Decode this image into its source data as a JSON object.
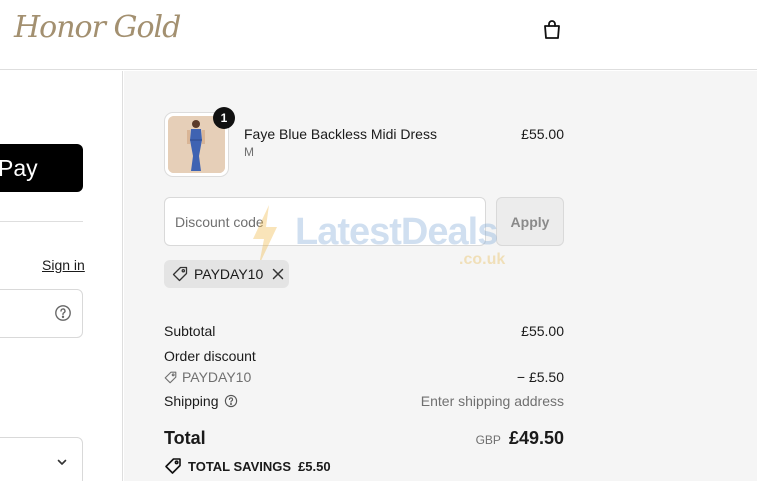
{
  "header": {
    "logo_text": "Honor Gold",
    "cart_icon": "shopping-bag-icon"
  },
  "left": {
    "pay_label": "Pay",
    "sign_in": "Sign in"
  },
  "order": {
    "product": {
      "name": "Faye Blue Backless Midi Dress",
      "variant": "M",
      "price": "£55.00",
      "quantity": "1"
    },
    "discount": {
      "placeholder": "Discount code",
      "apply_label": "Apply",
      "applied_code": "PAYDAY10"
    },
    "watermark": {
      "text": "LatestDeals",
      "sub": ".co.uk"
    },
    "summary": {
      "subtotal_label": "Subtotal",
      "subtotal_value": "£55.00",
      "discount_label": "Order discount",
      "discount_code": "PAYDAY10",
      "discount_value": "− £5.50",
      "shipping_label": "Shipping",
      "shipping_value": "Enter shipping address",
      "total_label": "Total",
      "currency": "GBP",
      "total_value": "£49.50",
      "savings_label": "TOTAL SAVINGS",
      "savings_value": "£5.50"
    }
  },
  "colors": {
    "accent_black": "#000000",
    "panel_bg": "#f5f5f5",
    "logo_gold": "#a39070"
  }
}
